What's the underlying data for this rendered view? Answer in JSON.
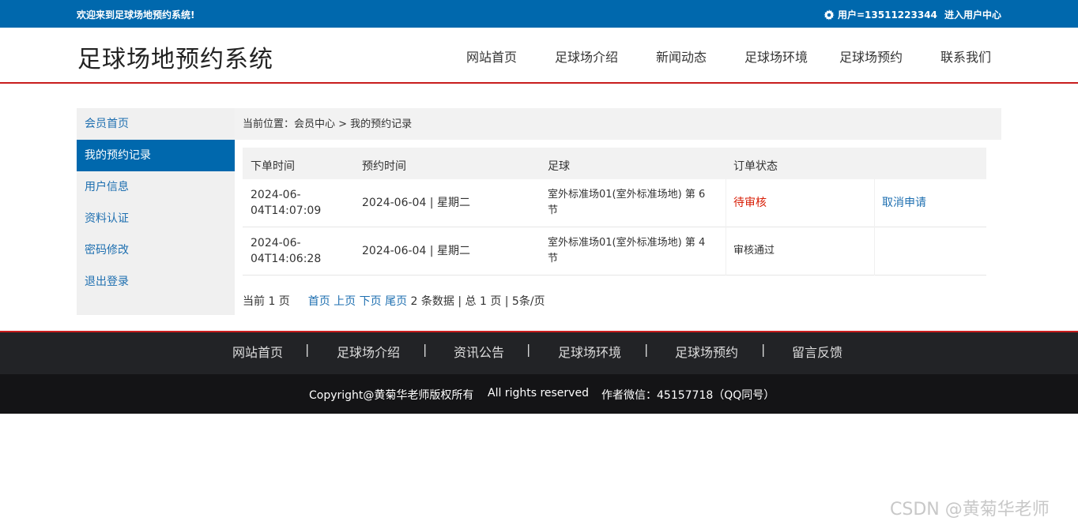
{
  "topbar": {
    "welcome": "欢迎来到足球场地预约系统!",
    "user_label": "用户=13511223344",
    "user_center": "进入用户中心"
  },
  "header": {
    "logo": "足球场地预约系统",
    "nav": [
      "网站首页",
      "足球场介绍",
      "新闻动态",
      "足球场环境",
      "足球场预约",
      "联系我们"
    ]
  },
  "sidebar": {
    "items": [
      "会员首页",
      "我的预约记录",
      "用户信息",
      "资料认证",
      "密码修改",
      "退出登录"
    ],
    "active": "我的预约记录"
  },
  "breadcrumb": "当前位置：会员中心 > 我的预约记录",
  "table": {
    "headers": [
      "下单时间",
      "预约时间",
      "足球",
      "订单状态"
    ],
    "rows": [
      {
        "order_time_1": "2024-06-",
        "order_time_2": "04T14:07:09",
        "reserve_time": "2024-06-04 | 星期二",
        "field_1": "室外标准场01(室外标准场地) 第 6",
        "field_2": "节",
        "status": "待审核",
        "action": "取消申请"
      },
      {
        "order_time_1": "2024-06-",
        "order_time_2": "04T14:06:28",
        "reserve_time": "2024-06-04 | 星期二",
        "field_1": "室外标准场01(室外标准场地) 第 4",
        "field_2": "节",
        "status": "审核通过",
        "action": ""
      }
    ]
  },
  "pager": {
    "current": "当前 1 页",
    "first": "首页",
    "prev": "上页",
    "next": "下页",
    "last": "尾页",
    "summary": "2 条数据 | 总 1 页 | 5条/页"
  },
  "footer": {
    "nav": [
      "网站首页",
      "足球场介绍",
      "资讯公告",
      "足球场环境",
      "足球场预约",
      "留言反馈"
    ],
    "separator": "|",
    "copyright": "Copyright@黄菊华老师版权所有",
    "rights": "All rights reserved",
    "contact": "作者微信：45157718（QQ同号）"
  },
  "watermark": "CSDN @黄菊华老师",
  "colors": {
    "primary_blue": "#0068ad",
    "accent_red": "#c81d1d",
    "link_blue": "#1e6fb0",
    "pending_red": "#d81e06",
    "footer_dark": "#222326"
  }
}
